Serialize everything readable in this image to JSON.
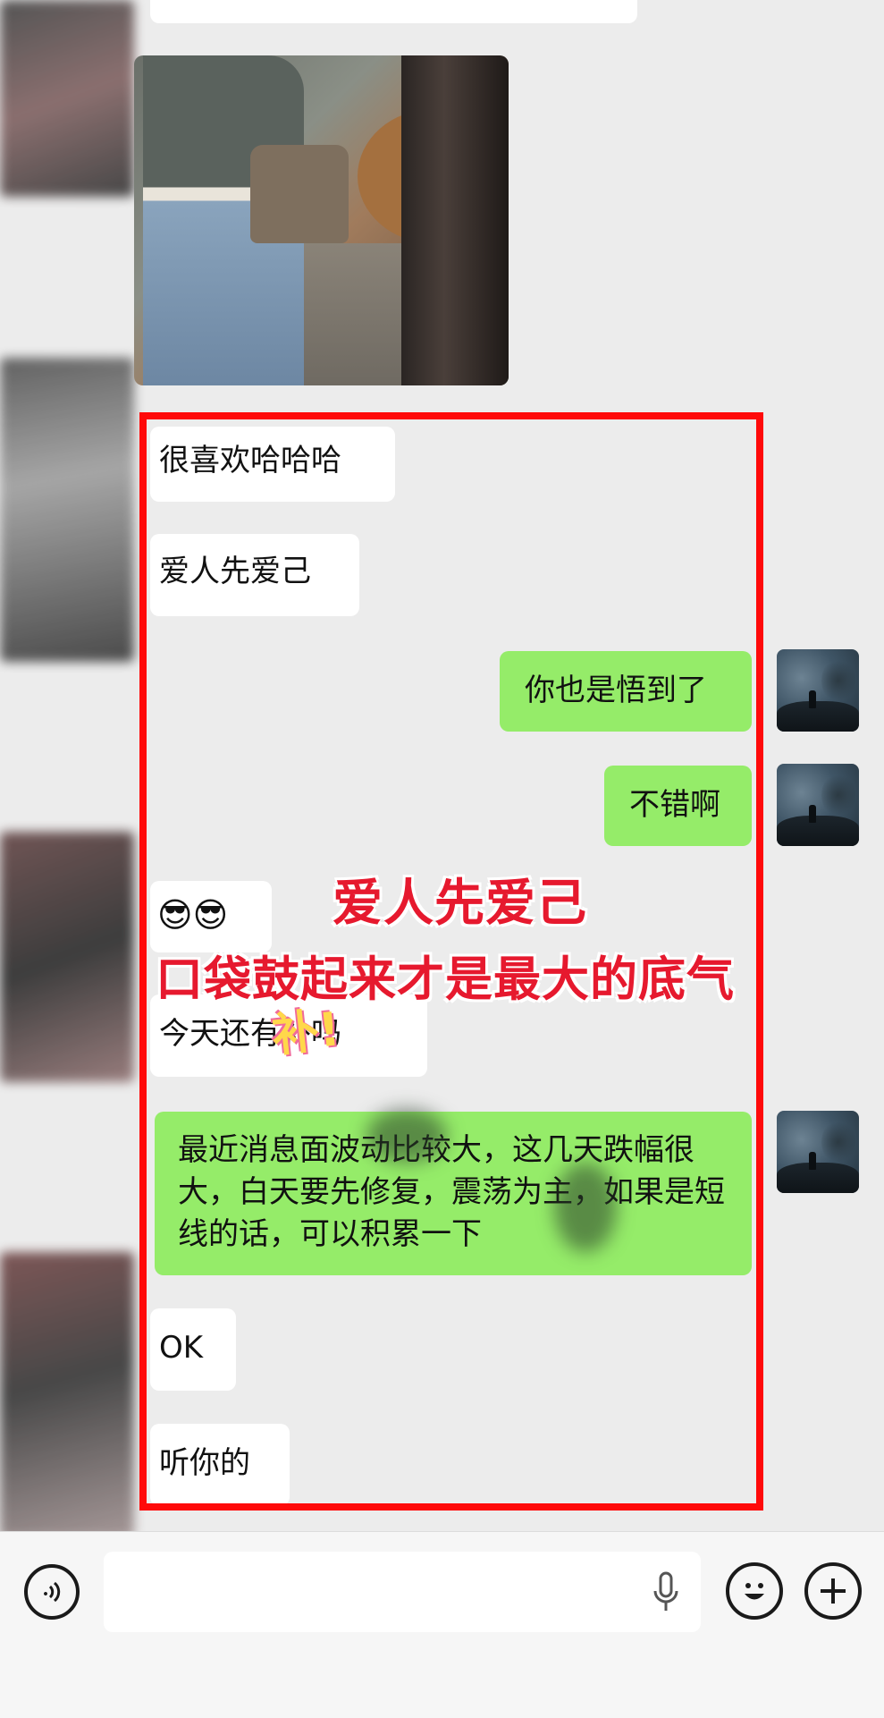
{
  "messages": {
    "m1": "很喜欢哈哈哈",
    "m2": "爱人先爱己",
    "m3": "你也是悟到了",
    "m4": "不错啊",
    "m5": "😎😎",
    "m6": "今天还有补吗",
    "m7": "最近消息面波动比较大，这几天跌幅很大，白天要先修复，震荡为主，如果是短线的话，可以积累一下",
    "m8": "OK",
    "m9": "听你的"
  },
  "overlay": {
    "line1": "爱人先爱己",
    "line2": "口袋鼓起来才是最大的底气",
    "sticker": "补!"
  },
  "colors": {
    "highlight": "#ff0a0a",
    "my_bubble": "#95ec69",
    "overlay_text": "#e6192e"
  },
  "icons": [
    "voice-icon",
    "microphone-icon",
    "emoji-icon",
    "plus-icon"
  ]
}
